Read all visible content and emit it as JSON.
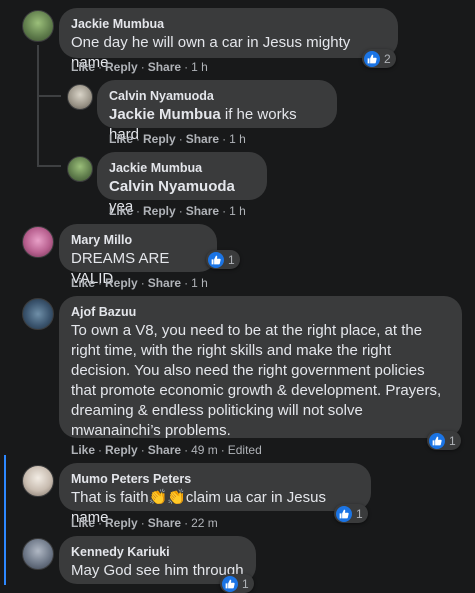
{
  "comments": [
    {
      "author": "Jackie Mumbua",
      "text": "One day he will own a car in Jesus mighty name",
      "like": "Like",
      "reply": "Reply",
      "share": "Share",
      "time": "1 h",
      "reaction_count": "2"
    },
    {
      "author": "Calvin Nyamuoda",
      "mention": "Jackie Mumbua",
      "text": " if he works hard",
      "like": "Like",
      "reply": "Reply",
      "share": "Share",
      "time": "1 h"
    },
    {
      "author": "Jackie Mumbua",
      "mention": "Calvin Nyamuoda",
      "text": " yea",
      "like": "Like",
      "reply": "Reply",
      "share": "Share",
      "time": "1 h"
    },
    {
      "author": "Mary Millo",
      "text": "DREAMS ARE VALID",
      "like": "Like",
      "reply": "Reply",
      "share": "Share",
      "time": "1 h",
      "reaction_count": "1"
    },
    {
      "author": "Ajof Bazuu",
      "text_lines": [
        "To own a V8, you need to be at the right place, at the",
        "right time, with the right skills and make the right",
        "decision. You also need the right government policies",
        "that promote economic growth & development. Prayers,",
        "dreaming & endless politicking will not solve",
        "mwanainchi’s problems."
      ],
      "like": "Like",
      "reply": "Reply",
      "share": "Share",
      "time": "49 m",
      "edited": "Edited",
      "reaction_count": "1"
    },
    {
      "author": "Mumo Peters Peters",
      "text_before": "That is faith",
      "text_after": "claim ua car in Jesus name",
      "like": "Like",
      "reply": "Reply",
      "share": "Share",
      "time": "22 m",
      "reaction_count": "1"
    },
    {
      "author": "Kennedy Kariuki",
      "text": "May God see him through",
      "reaction_count": "1"
    }
  ],
  "colors": {
    "background": "#18191a",
    "bubble": "#3a3b3c",
    "like_blue": "#1b74e4",
    "active_bar": "#2d88ff"
  },
  "icons": {
    "reaction": "thumbs-up-icon",
    "emoji": "clapping-hands-icon"
  }
}
